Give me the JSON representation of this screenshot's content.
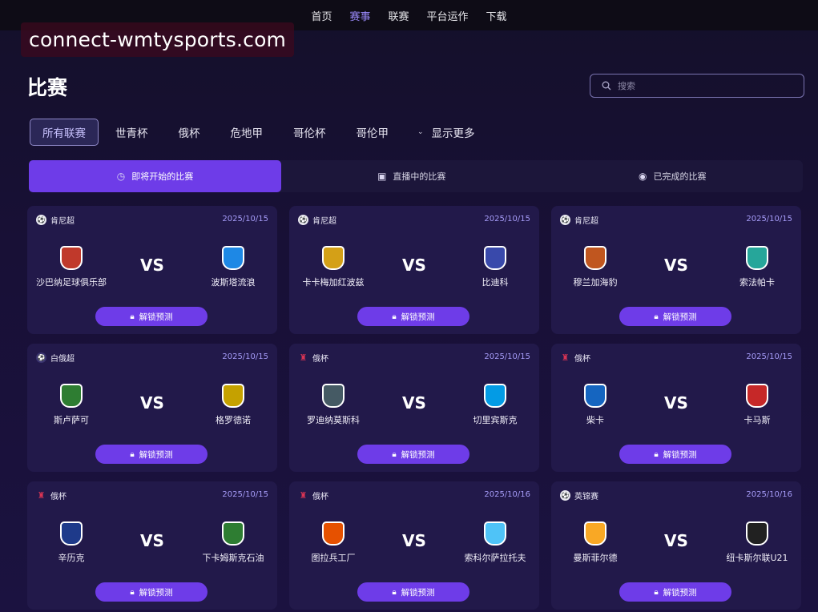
{
  "nav": {
    "items": [
      "首页",
      "赛事",
      "联赛",
      "平台运作",
      "下载"
    ],
    "active_index": 1
  },
  "watermark": "connect-wmtysports.com",
  "page": {
    "title": "比赛"
  },
  "search": {
    "placeholder": "搜索",
    "icon": "search-icon"
  },
  "filters": {
    "items": [
      "所有联赛",
      "世青杯",
      "俄杯",
      "危地甲",
      "哥伦杯",
      "哥伦甲"
    ],
    "active_index": 0,
    "more_label": "显示更多"
  },
  "status_tabs": [
    {
      "label": "即将开始的比赛",
      "icon": "clock-icon"
    },
    {
      "label": "直播中的比赛",
      "icon": "tv-icon"
    },
    {
      "label": "已完成的比赛",
      "icon": "check-circle-icon"
    }
  ],
  "status_tabs_active": 0,
  "matches": [
    {
      "league": "肯尼超",
      "date": "2025/10/15",
      "home": "沙巴纳足球俱乐部",
      "away": "波斯塔流浪",
      "vs": "VS",
      "button": "解锁预测",
      "home_color": "#c0392b",
      "away_color": "#1e88e5"
    },
    {
      "league": "肯尼超",
      "date": "2025/10/15",
      "home": "卡卡梅加红波兹",
      "away": "比迪科",
      "vs": "VS",
      "button": "解锁预测",
      "home_color": "#d4a017",
      "away_color": "#3949ab"
    },
    {
      "league": "肯尼超",
      "date": "2025/10/15",
      "home": "穆兰加海豹",
      "away": "索法帕卡",
      "vs": "VS",
      "button": "解锁预测",
      "home_color": "#c0561f",
      "away_color": "#26a69a"
    },
    {
      "league": "白俄超",
      "date": "2025/10/15",
      "home": "斯卢萨可",
      "away": "格罗德诺",
      "vs": "VS",
      "button": "解锁预测",
      "home_color": "#2e7d32",
      "away_color": "#c5a100"
    },
    {
      "league": "俄杯",
      "date": "2025/10/15",
      "home": "罗迪纳莫斯科",
      "away": "切里宾斯克",
      "vs": "VS",
      "button": "解锁预测",
      "home_color": "#455a64",
      "away_color": "#039be5"
    },
    {
      "league": "俄杯",
      "date": "2025/10/15",
      "home": "柴卡",
      "away": "卡马斯",
      "vs": "VS",
      "button": "解锁预测",
      "home_color": "#1565c0",
      "away_color": "#c62828"
    },
    {
      "league": "俄杯",
      "date": "2025/10/15",
      "home": "辛历克",
      "away": "下卡姆斯克石油",
      "vs": "VS",
      "button": "解锁预测",
      "home_color": "#1e3a8a",
      "away_color": "#2e7d32"
    },
    {
      "league": "俄杯",
      "date": "2025/10/16",
      "home": "图拉兵工厂",
      "away": "索科尔萨拉托夫",
      "vs": "VS",
      "button": "解锁预测",
      "home_color": "#e65100",
      "away_color": "#4fc3f7"
    },
    {
      "league": "英锦赛",
      "date": "2025/10/16",
      "home": "曼斯菲尔德",
      "away": "纽卡斯尔联U21",
      "vs": "VS",
      "button": "解锁预测",
      "home_color": "#f9a825",
      "away_color": "#212121"
    }
  ]
}
